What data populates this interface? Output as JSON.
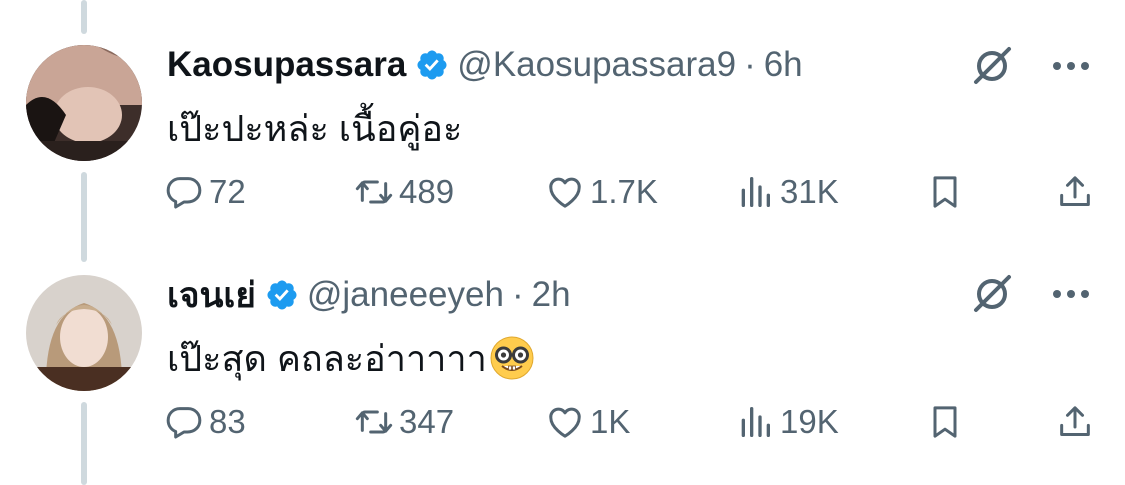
{
  "tweets": [
    {
      "display_name": "Kaosupassara",
      "handle": "@Kaosupassara9",
      "separator": "·",
      "time": "6h",
      "text": "เป๊ะปะหล่ะ เนื้อคู่อะ",
      "replies": "72",
      "reposts": "489",
      "likes": "1.7K",
      "views": "31K"
    },
    {
      "display_name": "เจนเย่",
      "handle": "@janeeeyeh",
      "separator": "·",
      "time": "2h",
      "text": "เป๊ะสุด คถละอ่าาาาา",
      "emoji": "nerd-face-emoji",
      "replies": "83",
      "reposts": "347",
      "likes": "1K",
      "views": "19K"
    }
  ],
  "icons": {
    "verified": "verified-badge-icon",
    "grok": "grok-icon",
    "more": "more-icon",
    "reply": "reply-icon",
    "repost": "repost-icon",
    "like": "like-icon",
    "views": "views-icon",
    "bookmark": "bookmark-icon",
    "share": "share-icon"
  },
  "colors": {
    "verified": "#1d9bf0",
    "text": "#0f1419",
    "secondary": "#536471",
    "thread_line": "#cfd9de"
  }
}
